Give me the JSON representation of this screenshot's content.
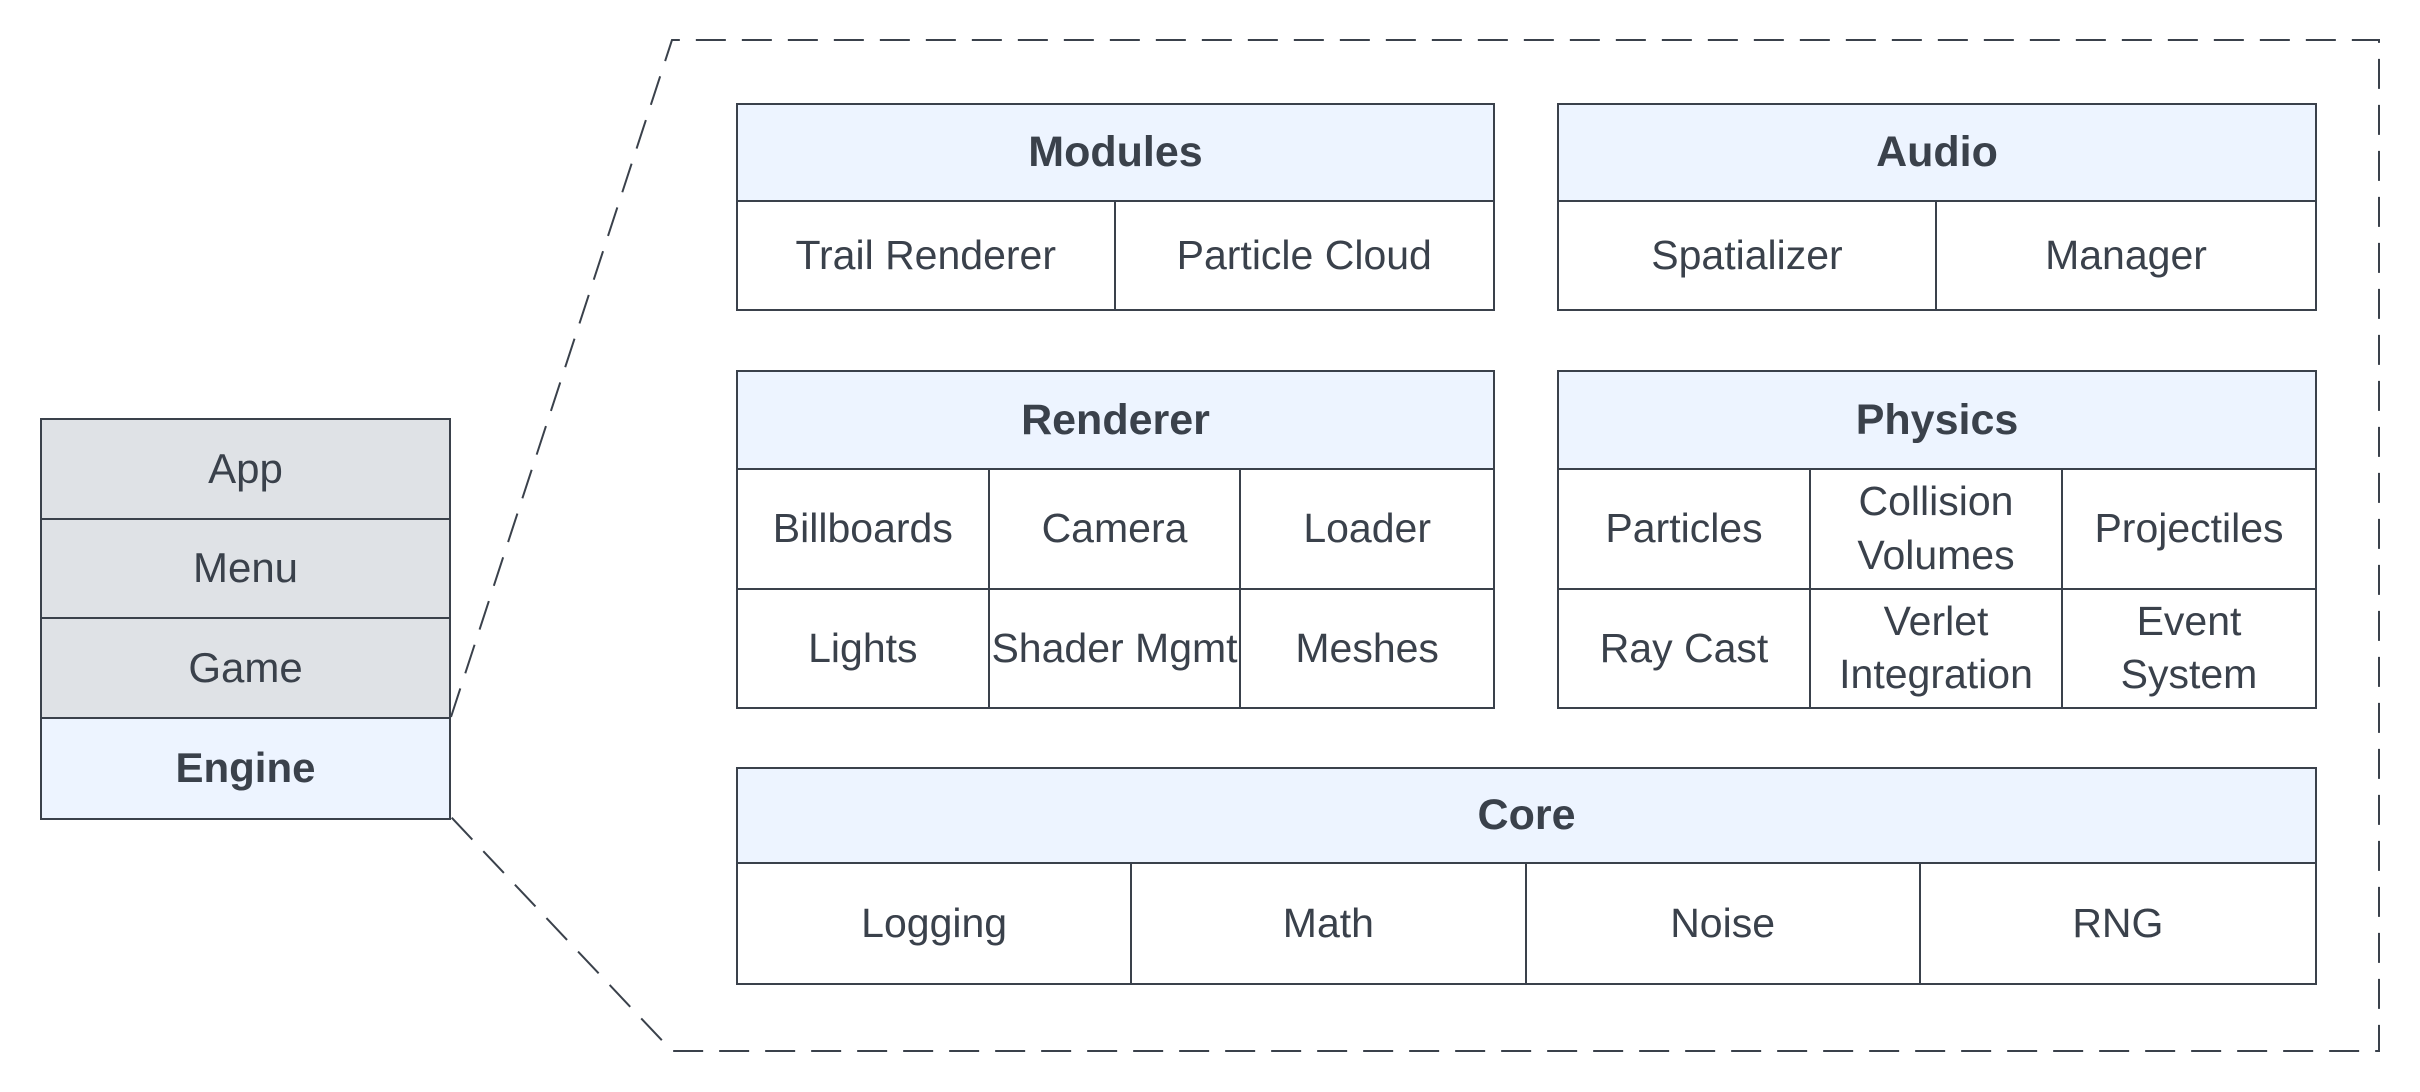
{
  "stack": [
    "App",
    "Menu",
    "Game",
    "Engine"
  ],
  "groups": {
    "modules": {
      "title": "Modules",
      "items": [
        "Trail Renderer",
        "Particle Cloud"
      ]
    },
    "audio": {
      "title": "Audio",
      "items": [
        "Spatializer",
        "Manager"
      ]
    },
    "renderer": {
      "title": "Renderer",
      "items": [
        "Billboards",
        "Camera",
        "Loader",
        "Lights",
        "Shader Mgmt",
        "Meshes"
      ]
    },
    "physics": {
      "title": "Physics",
      "items": [
        "Particles",
        "Collision Volumes",
        "Projectiles",
        "Ray Cast",
        "Verlet Integration",
        "Event System"
      ]
    },
    "core": {
      "title": "Core",
      "items": [
        "Logging",
        "Math",
        "Noise",
        "RNG"
      ]
    }
  },
  "colors": {
    "stroke": "#3a414b",
    "highlight": "#edf4ff",
    "layer": "#dfe2e6"
  }
}
